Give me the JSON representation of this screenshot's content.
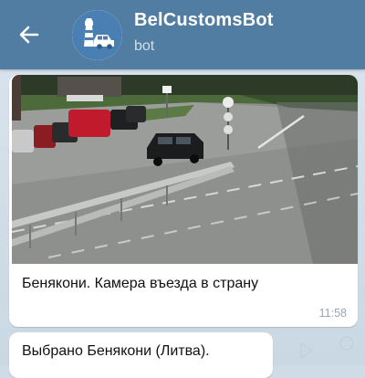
{
  "header": {
    "title": "BelCustomsBot",
    "subtitle": "bot",
    "back_icon": "arrow-left-icon",
    "avatar_icon": "customs-lighthouse-car-logo",
    "bg_color": "#517da2"
  },
  "messages": [
    {
      "type": "photo",
      "caption": "Бенякони. Камера въезда в страну",
      "time": "11:58"
    },
    {
      "type": "text",
      "text": "Выбрано Бенякони (Литва)."
    }
  ]
}
